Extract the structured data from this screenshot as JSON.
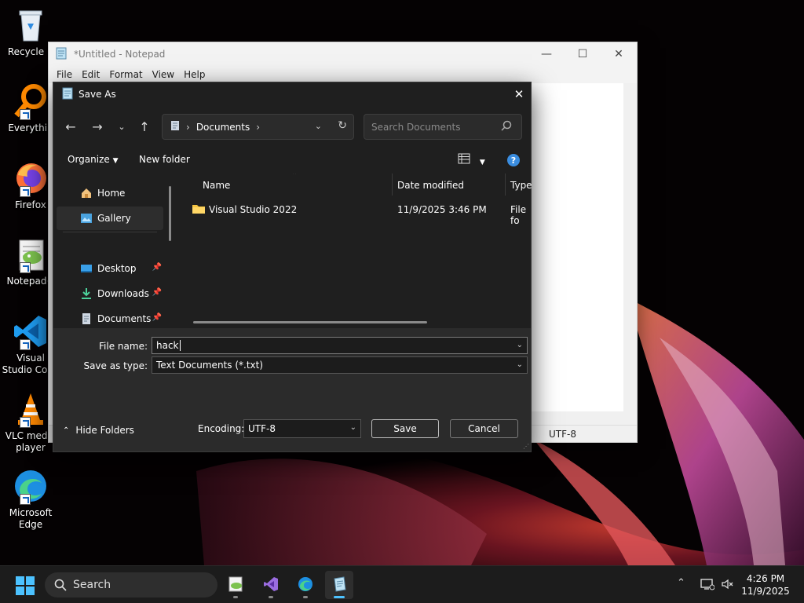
{
  "desktop": {
    "icons": [
      {
        "label": "Recycle B",
        "icon": "recycle-bin-icon"
      },
      {
        "label": "Everythin",
        "icon": "everything-search-icon"
      },
      {
        "label": "Firefox",
        "icon": "firefox-icon"
      },
      {
        "label": "Notepad+",
        "icon": "notepadpp-icon"
      },
      {
        "label": "Visual Studio Code",
        "icon": "vscode-icon"
      },
      {
        "label": "VLC media player",
        "icon": "vlc-icon"
      },
      {
        "label": "Microsoft Edge",
        "icon": "edge-icon"
      }
    ]
  },
  "notepad": {
    "title": "*Untitled - Notepad",
    "menu": [
      "File",
      "Edit",
      "Format",
      "View",
      "Help"
    ],
    "controls": {
      "minimize": "—",
      "maximize": "☐",
      "close": "✕"
    },
    "status_encoding": "UTF-8"
  },
  "dialog": {
    "title": "Save As",
    "close": "✕",
    "address": {
      "location": "Documents"
    },
    "search_placeholder": "Search Documents",
    "commands": {
      "organize": "Organize",
      "new_folder": "New folder"
    },
    "help_label": "?",
    "nav": [
      {
        "label": "Home",
        "icon": "home-icon",
        "pinned": false,
        "selected": false
      },
      {
        "label": "Gallery",
        "icon": "gallery-icon",
        "pinned": false,
        "selected": true
      },
      {
        "label": "Desktop",
        "icon": "desktop-icon",
        "pinned": true,
        "selected": false
      },
      {
        "label": "Downloads",
        "icon": "download-icon",
        "pinned": true,
        "selected": false
      },
      {
        "label": "Documents",
        "icon": "documents-icon",
        "pinned": true,
        "selected": false
      }
    ],
    "columns": [
      "Name",
      "Date modified",
      "Type"
    ],
    "files": [
      {
        "name": "Visual Studio 2022",
        "date": "11/9/2025 3:46 PM",
        "type": "File fo"
      }
    ],
    "file_name_label": "File name:",
    "file_name_value": "hack",
    "save_type_label": "Save as type:",
    "save_type_value": "Text Documents (*.txt)",
    "hide_folders": "Hide Folders",
    "encoding_label": "Encoding:",
    "encoding_value": "UTF-8",
    "save_button": "Save",
    "cancel_button": "Cancel"
  },
  "taskbar": {
    "search_label": "Search",
    "apps": [
      "notepadpp-icon",
      "visual-studio-icon",
      "edge-icon",
      "notepad-icon"
    ],
    "time": "4:26 PM",
    "date": "11/9/2025"
  }
}
